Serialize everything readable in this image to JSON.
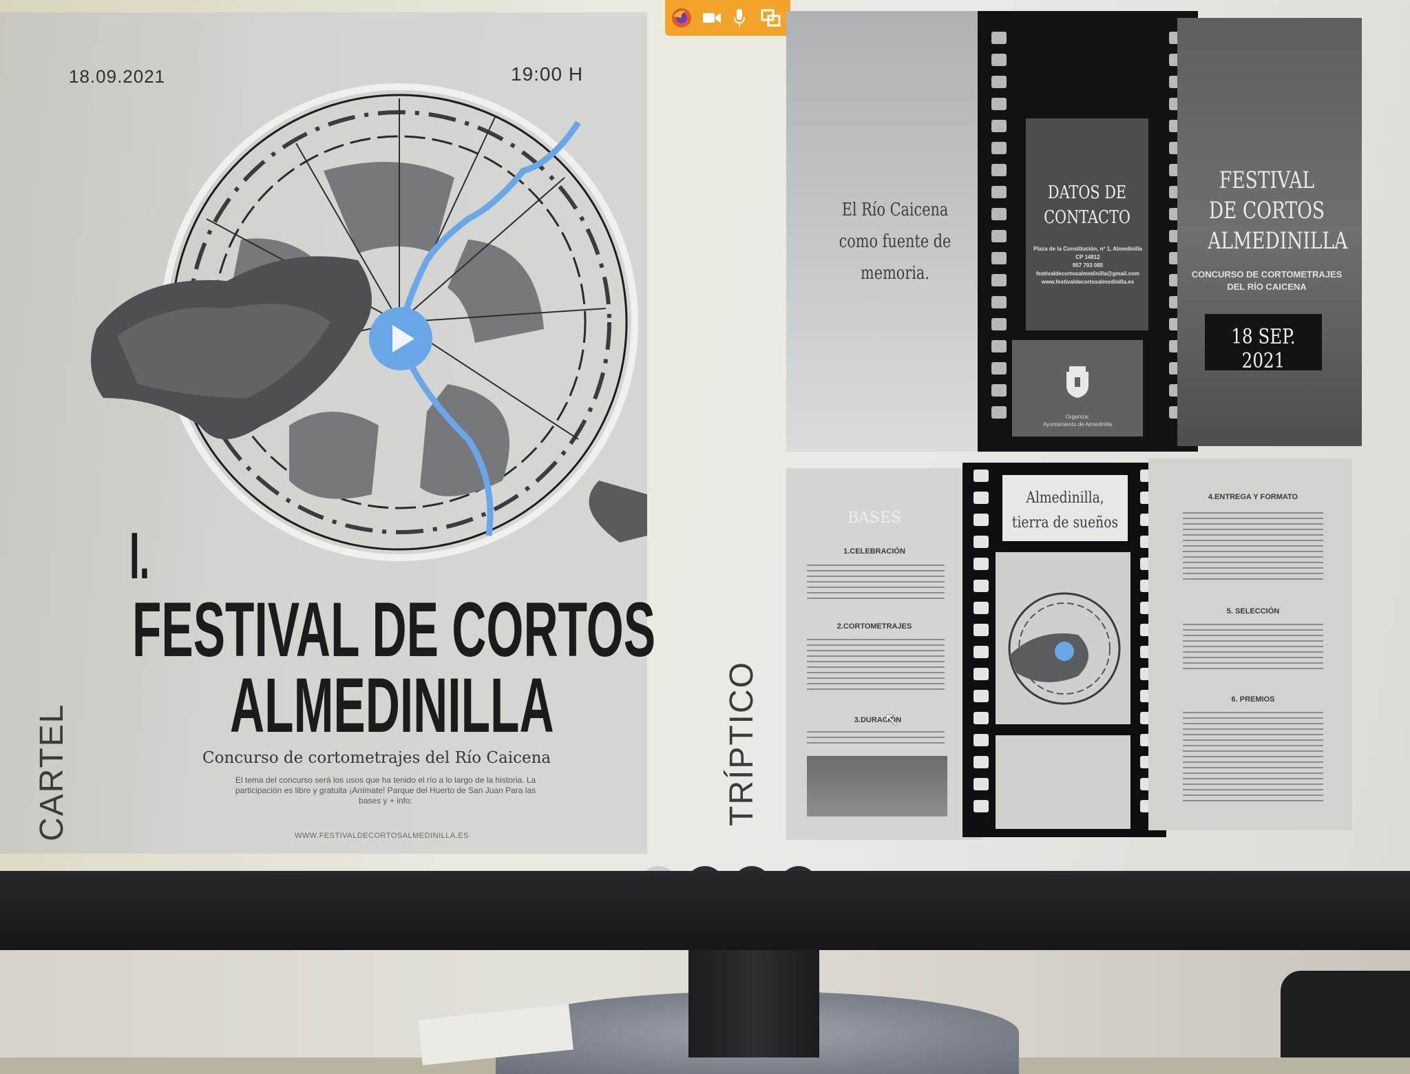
{
  "poster": {
    "date": "18.09.2021",
    "time": "19:00 H",
    "ordinal": "I.",
    "title_line1": "FESTIVAL DE CORTOS",
    "title_line2": "ALMEDINILLA",
    "subtitle": "Concurso de cortometrajes del Río Caicena",
    "body": "El tema del concurso será los usos que ha tenido el río a lo largo de la historia. La participación es libre y gratuita ¡Anímate! Parque del Huerto de San Juan Para las bases y + info:",
    "url": "WWW.FESTIVALDECORTOSALMEDINILLA.ES"
  },
  "labels": {
    "cartel": "CARTEL",
    "triptico": "TRÍPTICO"
  },
  "triptych": {
    "rio_text": "El Río Caicena como fuente de memoria.",
    "contact_title": "DATOS DE CONTACTO",
    "contact_lines": [
      "Plaza de la Constitución, nº 1, Almedinilla",
      "CP 14812",
      "957 703 085",
      "festivaldecortosalmedinilla@gmail.com",
      "www.festivaldecortosalmedinilla.es"
    ],
    "organiza": "Organiza:",
    "organizer": "Ayuntamiento de Almedinilla",
    "festival_title": "FESTIVAL DE CORTOS ALMEDINILLA",
    "festival_sub": "CONCURSO DE CORTOMETRAJES DEL RÍO CAICENA",
    "festival_date": "18 SEP. 2021",
    "bases_title": "BASES",
    "sec1": "1.CELEBRACIÓN",
    "sec2": "2.CORTOMETRAJES",
    "sec3": "3.DURACIÓN",
    "sueno": "Almedinilla, tierra de sueños",
    "sec4": "4.ENTREGA Y FORMATO",
    "sec5": "5. SELECCIÓN",
    "sec6": "6. PREMIOS"
  },
  "icons": {
    "browser": "firefox-icon",
    "camera": "video-camera-icon",
    "mic": "microphone-icon",
    "screen": "screen-share-icon"
  },
  "colors": {
    "toolbar": "#f2a42a",
    "river": "#6aa7e8",
    "ok": "#3fae49"
  }
}
